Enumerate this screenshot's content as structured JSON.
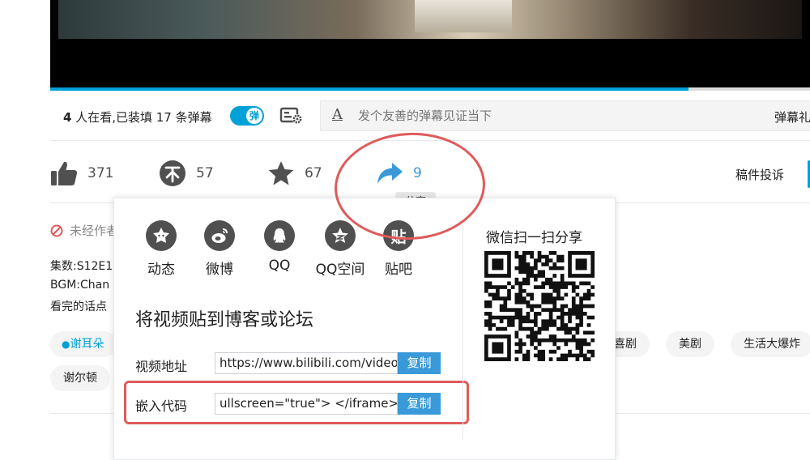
{
  "player": {
    "progress_fraction": 0.84,
    "viewer_count": "4",
    "viewer_text_mid": " 人在看,已装填 ",
    "danmaku_count": "17",
    "danmaku_text_end": " 条弹幕",
    "toggle_label": "弹",
    "input_placeholder": "发个友善的弹幕见证当下",
    "etiquette_label": "弹幕礼"
  },
  "actions": {
    "like_count": "371",
    "coin_count": "57",
    "favorite_count": "67",
    "share_count": "9",
    "share_tooltip": "分享",
    "report_label": "稿件投诉"
  },
  "info": {
    "no_repost": "未经作者",
    "desc_line1": "集数:S12E1",
    "desc_line2": "BGM:Chan",
    "desc_line3": "看完的话点",
    "tags": [
      "谢耳朵",
      "喜剧",
      "美剧",
      "生活大爆炸",
      "谢尔顿"
    ]
  },
  "share_panel": {
    "platforms": [
      {
        "label": "动态",
        "icon": "dynamic-icon"
      },
      {
        "label": "微博",
        "icon": "weibo-icon"
      },
      {
        "label": "QQ",
        "icon": "qq-icon"
      },
      {
        "label": "QQ空间",
        "icon": "qzone-icon"
      },
      {
        "label": "贴吧",
        "icon": "tieba-icon",
        "glyph": "贴"
      }
    ],
    "embed_title": "将视频贴到博客或论坛",
    "video_url_label": "视频地址",
    "video_url_value": "https://www.bilibili.com/video",
    "embed_code_label": "嵌入代码",
    "embed_code_value": "ullscreen=\"true\"> </iframe>",
    "copy_label": "复制",
    "wechat_title": "微信扫一扫分享"
  },
  "colors": {
    "accent": "#00a1d6",
    "share_blue": "#3a9ad9",
    "annotation_red": "#e05a5a",
    "icon_gray": "#505050"
  }
}
